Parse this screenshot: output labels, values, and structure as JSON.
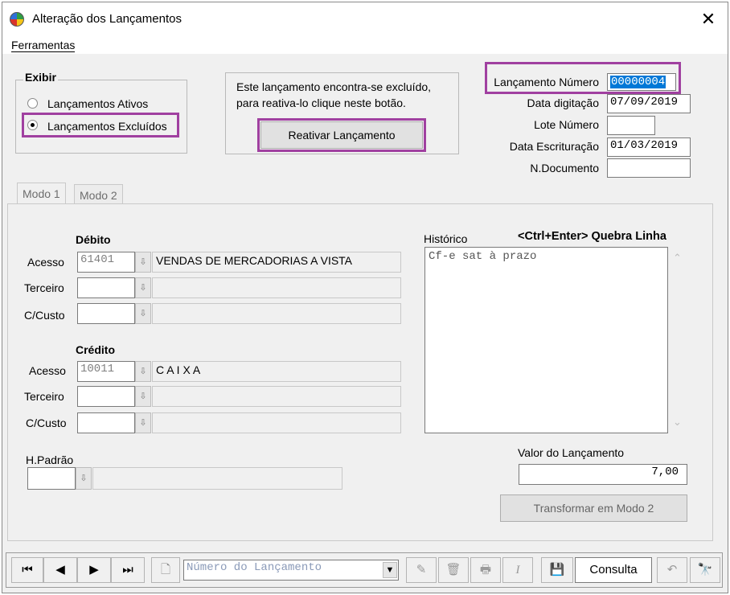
{
  "window": {
    "title": "Alteração dos Lançamentos",
    "close_label": "✕"
  },
  "menu": {
    "ferramentas": "Ferramentas"
  },
  "exibir": {
    "title": "Exibir",
    "options": [
      {
        "label": "Lançamentos Ativos",
        "checked": false
      },
      {
        "label": "Lançamentos Excluídos",
        "checked": true
      }
    ]
  },
  "notice": {
    "line1": "Este lançamento encontra-se excluído,",
    "line2": "para reativa-lo clique neste botão.",
    "button_label": "Reativar Lançamento"
  },
  "header_fields": {
    "lancamento_numero_label": "Lançamento Número",
    "lancamento_numero_value": "00000004",
    "data_digitacao_label": "Data digitação",
    "data_digitacao_value": "07/09/2019",
    "lote_numero_label": "Lote Número",
    "lote_numero_value": "",
    "data_escrituracao_label": "Data Escrituração",
    "data_escrituracao_value": "01/03/2019",
    "n_documento_label": "N.Documento",
    "n_documento_value": ""
  },
  "tabs": [
    {
      "label": "Modo 1",
      "active": true
    },
    {
      "label": "Modo 2",
      "active": false
    }
  ],
  "debito": {
    "title": "Débito",
    "acesso_label": "Acesso",
    "acesso_code": "61401",
    "acesso_desc": "VENDAS DE MERCADORIAS A VISTA",
    "terceiro_label": "Terceiro",
    "terceiro_value": "",
    "ccusto_label": "C/Custo",
    "ccusto_value": ""
  },
  "credito": {
    "title": "Crédito",
    "acesso_label": "Acesso",
    "acesso_code": "10011",
    "acesso_desc": "C A I X A",
    "terceiro_label": "Terceiro",
    "terceiro_value": "",
    "ccusto_label": "C/Custo",
    "ccusto_value": ""
  },
  "hpadrao": {
    "label": "H.Padrão",
    "value": ""
  },
  "historico": {
    "label": "Histórico",
    "hint": "<Ctrl+Enter> Quebra Linha",
    "text": "Cf-e sat  à prazo"
  },
  "valor": {
    "label": "Valor do Lançamento",
    "value": "7,00"
  },
  "transformar_button": "Transformar em Modo 2",
  "toolbar": {
    "search_placeholder": "Número do Lançamento",
    "mode_text": "Consulta"
  },
  "colors": {
    "highlight": "#a040a0",
    "selection": "#0078d7"
  }
}
